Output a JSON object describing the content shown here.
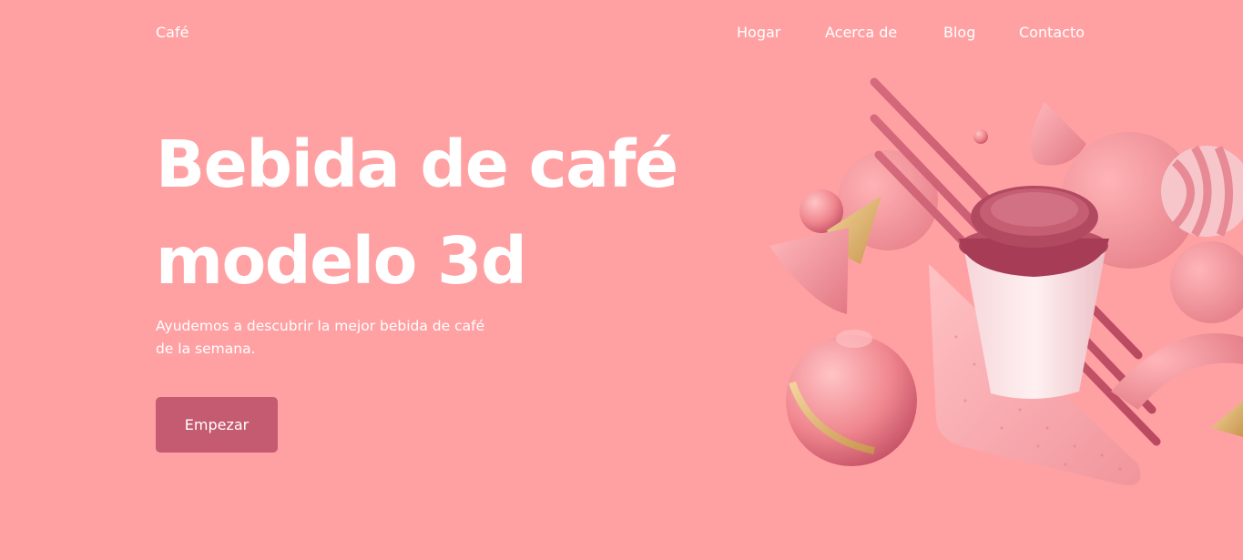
{
  "header": {
    "logo": "Café",
    "nav": [
      "Hogar",
      "Acerca de",
      "Blog",
      "Contacto"
    ]
  },
  "hero": {
    "title_line1": "Bebida de café",
    "title_line2": "modelo 3d",
    "subtitle_line1": "Ayudemos a descubrir la mejor bebida de café",
    "subtitle_line2": "de la semana.",
    "cta_label": "Empezar"
  },
  "theme": {
    "background": "#FFA1A3",
    "button": "#C45B70",
    "text": "#FFFFFF"
  },
  "illustration": {
    "subject": "3d-coffee-cup-with-pink-shapes"
  }
}
